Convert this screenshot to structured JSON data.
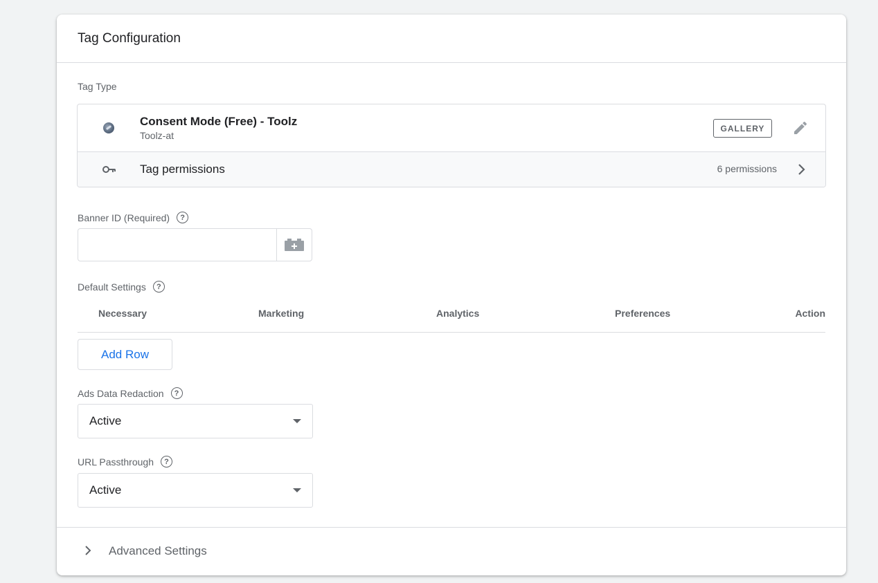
{
  "card": {
    "title": "Tag Configuration"
  },
  "tag_type": {
    "label": "Tag Type",
    "name": "Consent Mode (Free) - Toolz",
    "vendor": "Toolz-at",
    "badge": "GALLERY",
    "permissions_label": "Tag permissions",
    "permissions_count": "6 permissions"
  },
  "banner_id": {
    "label": "Banner ID (Required)",
    "value": ""
  },
  "default_settings": {
    "label": "Default Settings",
    "columns": [
      "Necessary",
      "Marketing",
      "Analytics",
      "Preferences",
      "Action"
    ],
    "add_row_label": "Add Row"
  },
  "ads_data_redaction": {
    "label": "Ads Data Redaction",
    "selected": "Active"
  },
  "url_passthrough": {
    "label": "URL Passthrough",
    "selected": "Active"
  },
  "advanced": {
    "label": "Advanced Settings"
  },
  "icons": {
    "help": "help-icon",
    "edit": "pencil-icon",
    "permissions": "key-icon",
    "variable": "variable-picker-icon"
  },
  "colors": {
    "accent": "#1a73e8",
    "border": "#dadce0",
    "muted_text": "#5f6368",
    "background": "#f1f3f4"
  }
}
